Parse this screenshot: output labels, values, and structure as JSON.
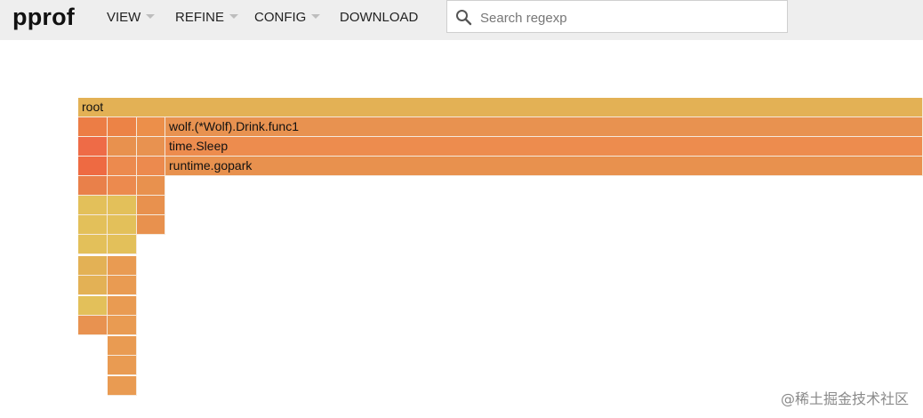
{
  "app": {
    "title": "pprof"
  },
  "menus": [
    {
      "label": "VIEW",
      "has_caret": true
    },
    {
      "label": "REFINE",
      "has_caret": true
    },
    {
      "label": "CONFIG",
      "has_caret": true
    },
    {
      "label": "DOWNLOAD",
      "has_caret": false
    }
  ],
  "search": {
    "placeholder": "Search regexp",
    "value": ""
  },
  "flamegraph": {
    "frames": [
      {
        "name": "root",
        "label": "root",
        "color": "#e3b155"
      },
      {
        "name": "wolf-drink-func1",
        "label": "wolf.(*Wolf).Drink.func1",
        "color": "#ec7d45"
      },
      {
        "name": "time-sleep",
        "label": "time.Sleep",
        "color": "#ec8346"
      },
      {
        "name": "runtime-gopark",
        "label": "runtime.gopark",
        "color": "#ec8f4a"
      },
      {
        "color": "#e89250"
      },
      {
        "color": "#ee6b47"
      },
      {
        "color": "#e8914e"
      },
      {
        "color": "#e89250"
      },
      {
        "color": "#ed8c4e"
      },
      {
        "color": "#ee6a42"
      },
      {
        "color": "#ec8a4e"
      },
      {
        "color": "#ec8a4e"
      },
      {
        "color": "#e8914e"
      },
      {
        "color": "#e9804a"
      },
      {
        "color": "#ec8a4e"
      },
      {
        "color": "#e8914e"
      },
      {
        "color": "#e3c05a"
      },
      {
        "color": "#e3c05a"
      },
      {
        "color": "#e8914e"
      },
      {
        "color": "#e3c05a"
      },
      {
        "color": "#e3c05a"
      },
      {
        "color": "#e8914e"
      },
      {
        "color": "#e3c05a"
      },
      {
        "color": "#e3c05a"
      },
      {
        "color": "#e3b155"
      },
      {
        "color": "#e99b52"
      },
      {
        "color": "#e3b155"
      },
      {
        "color": "#e99b52"
      },
      {
        "color": "#e3c05a"
      },
      {
        "color": "#e99b52"
      },
      {
        "color": "#e89250"
      },
      {
        "color": "#e99b52"
      },
      {
        "color": "#e99b52"
      },
      {
        "color": "#e99b52"
      },
      {
        "color": "#e99b52"
      }
    ]
  },
  "watermark": "@稀土掘金技术社区"
}
